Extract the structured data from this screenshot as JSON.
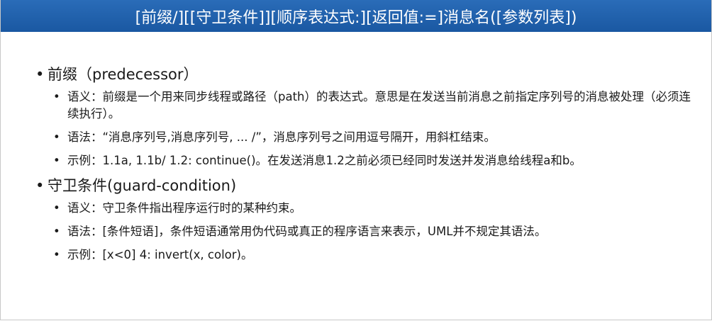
{
  "slide": {
    "title": "[前缀/][[守卫条件]][顺序表达式:][返回值:=]消息名([参数列表])",
    "sections": [
      {
        "heading": "前缀（predecessor）",
        "items": [
          "语义：前缀是一个用来同步线程或路径（path）的表达式。意思是在发送当前消息之前指定序列号的消息被处理（必须连续执行）。",
          "语法：“消息序列号,消息序列号, ... /”，消息序列号之间用逗号隔开，用斜杠结束。",
          "示例：1.1a, 1.1b/ 1.2: continue()。在发送消息1.2之前必须已经同时发送并发消息给线程a和b。"
        ]
      },
      {
        "heading": "守卫条件(guard-condition)",
        "items": [
          "语义：守卫条件指出程序运行时的某种约束。",
          "语法：[条件短语]，条件短语通常用伪代码或真正的程序语言来表示，UML并不规定其语法。",
          "示例：[x<0] 4: invert(x, color)。"
        ]
      }
    ],
    "bullet": "•",
    "title_bar_color": "#1f5fa8"
  }
}
